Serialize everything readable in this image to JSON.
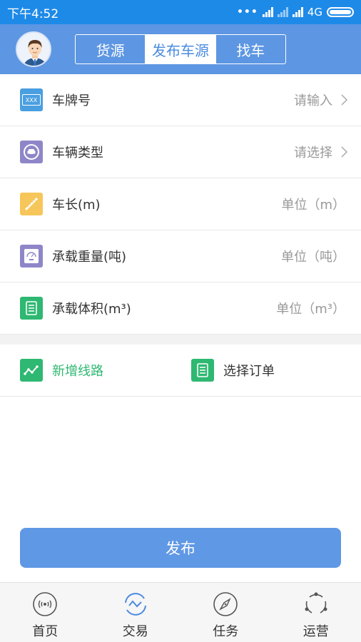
{
  "status_bar": {
    "time": "下午4:52",
    "network": "4G"
  },
  "header": {
    "tabs": [
      {
        "label": "货源",
        "active": false
      },
      {
        "label": "发布车源",
        "active": true
      },
      {
        "label": "找车",
        "active": false
      }
    ]
  },
  "form": {
    "plate": {
      "label": "车牌号",
      "placeholder": "请输入",
      "icon_text": "XXX"
    },
    "vehicle_type": {
      "label": "车辆类型",
      "placeholder": "请选择"
    },
    "length": {
      "label": "车长(m)",
      "placeholder": "单位（m）"
    },
    "load_weight": {
      "label": "承载重量(吨)",
      "placeholder": "单位（吨）"
    },
    "load_volume": {
      "label": "承载体积(m³)",
      "placeholder": "单位（m³）"
    }
  },
  "actions": {
    "add_route": "新增线路",
    "select_order": "选择订单"
  },
  "publish_button": "发布",
  "bottom_nav": [
    {
      "label": "首页",
      "icon": "home-radar-icon",
      "active": false
    },
    {
      "label": "交易",
      "icon": "trade-icon",
      "active": true
    },
    {
      "label": "任务",
      "icon": "compass-icon",
      "active": false
    },
    {
      "label": "运营",
      "icon": "operations-icon",
      "active": false
    }
  ],
  "colors": {
    "status_bar": "#1e8ae8",
    "header": "#5d96e3",
    "accent_green": "#2eb872",
    "publish_button": "#5f98e5",
    "icon_blue": "#4a9fe0",
    "icon_purple": "#8e86c8",
    "icon_yellow": "#f7c65a"
  }
}
